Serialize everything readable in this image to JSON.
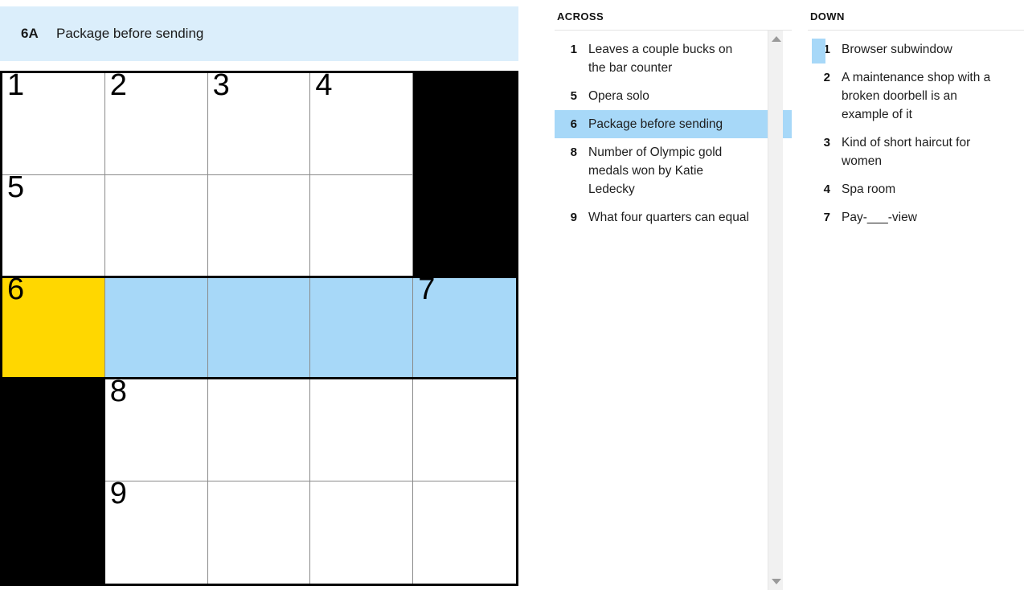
{
  "clue_banner": {
    "number": "6A",
    "text": "Package before sending"
  },
  "grid": {
    "rows": 5,
    "cols": 5,
    "colors": {
      "active": "#FFD700",
      "highlight": "#A7D8F8",
      "block": "#000000",
      "empty": "#FFFFFF",
      "banner": "#DBEEFB"
    },
    "cells": [
      [
        {
          "number": "1",
          "state": "empty",
          "letter": ""
        },
        {
          "number": "2",
          "state": "empty",
          "letter": ""
        },
        {
          "number": "3",
          "state": "empty",
          "letter": ""
        },
        {
          "number": "4",
          "state": "empty",
          "letter": ""
        },
        {
          "number": "",
          "state": "block",
          "letter": ""
        }
      ],
      [
        {
          "number": "5",
          "state": "empty",
          "letter": ""
        },
        {
          "number": "",
          "state": "empty",
          "letter": ""
        },
        {
          "number": "",
          "state": "empty",
          "letter": ""
        },
        {
          "number": "",
          "state": "empty",
          "letter": ""
        },
        {
          "number": "",
          "state": "block",
          "letter": ""
        }
      ],
      [
        {
          "number": "6",
          "state": "active",
          "letter": ""
        },
        {
          "number": "",
          "state": "highlight",
          "letter": ""
        },
        {
          "number": "",
          "state": "highlight",
          "letter": ""
        },
        {
          "number": "",
          "state": "highlight",
          "letter": ""
        },
        {
          "number": "7",
          "state": "highlight",
          "letter": ""
        }
      ],
      [
        {
          "number": "",
          "state": "block",
          "letter": ""
        },
        {
          "number": "8",
          "state": "empty",
          "letter": ""
        },
        {
          "number": "",
          "state": "empty",
          "letter": ""
        },
        {
          "number": "",
          "state": "empty",
          "letter": ""
        },
        {
          "number": "",
          "state": "empty",
          "letter": ""
        }
      ],
      [
        {
          "number": "",
          "state": "block",
          "letter": ""
        },
        {
          "number": "9",
          "state": "empty",
          "letter": ""
        },
        {
          "number": "",
          "state": "empty",
          "letter": ""
        },
        {
          "number": "",
          "state": "empty",
          "letter": ""
        },
        {
          "number": "",
          "state": "empty",
          "letter": ""
        }
      ]
    ]
  },
  "across": {
    "title": "ACROSS",
    "clues": [
      {
        "number": "1",
        "text": "Leaves a couple bucks on the bar counter",
        "selected": false,
        "marked": false
      },
      {
        "number": "5",
        "text": "Opera solo",
        "selected": false,
        "marked": false
      },
      {
        "number": "6",
        "text": "Package before sending",
        "selected": true,
        "marked": false
      },
      {
        "number": "8",
        "text": "Number of Olympic gold medals won by Katie Ledecky",
        "selected": false,
        "marked": false
      },
      {
        "number": "9",
        "text": "What four quarters can equal",
        "selected": false,
        "marked": false
      }
    ]
  },
  "down": {
    "title": "DOWN",
    "clues": [
      {
        "number": "1",
        "text": "Browser subwindow",
        "selected": false,
        "marked": true
      },
      {
        "number": "2",
        "text": "A maintenance shop with a broken doorbell is an example of it",
        "selected": false,
        "marked": false
      },
      {
        "number": "3",
        "text": "Kind of short haircut for women",
        "selected": false,
        "marked": false
      },
      {
        "number": "4",
        "text": "Spa room",
        "selected": false,
        "marked": false
      },
      {
        "number": "7",
        "text": "Pay-___-view",
        "selected": false,
        "marked": false
      }
    ]
  },
  "scrollbar": {
    "up_icon": "triangle-up-icon",
    "down_icon": "triangle-down-icon"
  }
}
